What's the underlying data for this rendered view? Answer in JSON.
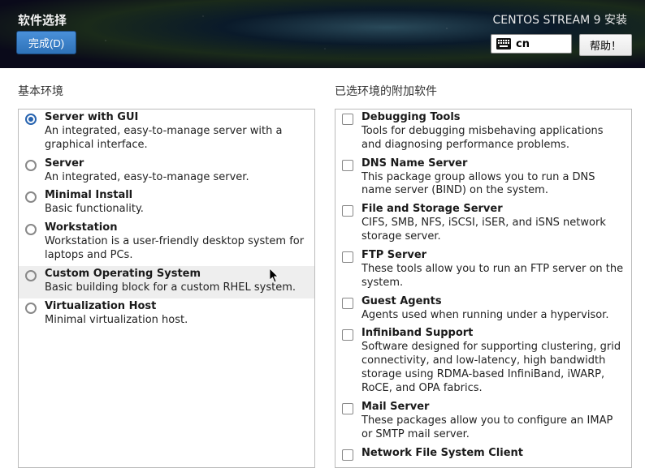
{
  "header": {
    "title": "软件选择",
    "done_label": "完成(D)",
    "installer_title": "CENTOS STREAM 9 安装",
    "lang_code": "cn",
    "help_label": "帮助！"
  },
  "left": {
    "heading": "基本环境",
    "items": [
      {
        "title": "Server with GUI",
        "desc": "An integrated, easy-to-manage server with a graphical interface.",
        "selected": true
      },
      {
        "title": "Server",
        "desc": "An integrated, easy-to-manage server.",
        "selected": false
      },
      {
        "title": "Minimal Install",
        "desc": "Basic functionality.",
        "selected": false
      },
      {
        "title": "Workstation",
        "desc": "Workstation is a user-friendly desktop system for laptops and PCs.",
        "selected": false
      },
      {
        "title": "Custom Operating System",
        "desc": "Basic building block for a custom RHEL system.",
        "selected": false,
        "hovered": true
      },
      {
        "title": "Virtualization Host",
        "desc": "Minimal virtualization host.",
        "selected": false
      }
    ]
  },
  "right": {
    "heading": "已选环境的附加软件",
    "items": [
      {
        "title": "Debugging Tools",
        "desc": "Tools for debugging misbehaving applications and diagnosing performance problems."
      },
      {
        "title": "DNS Name Server",
        "desc": "This package group allows you to run a DNS name server (BIND) on the system."
      },
      {
        "title": "File and Storage Server",
        "desc": "CIFS, SMB, NFS, iSCSI, iSER, and iSNS network storage server."
      },
      {
        "title": "FTP Server",
        "desc": "These tools allow you to run an FTP server on the system."
      },
      {
        "title": "Guest Agents",
        "desc": "Agents used when running under a hypervisor."
      },
      {
        "title": "Infiniband Support",
        "desc": "Software designed for supporting clustering, grid connectivity, and low-latency, high bandwidth storage using RDMA-based InfiniBand, iWARP, RoCE, and OPA fabrics."
      },
      {
        "title": "Mail Server",
        "desc": "These packages allow you to configure an IMAP or SMTP mail server."
      },
      {
        "title": "Network File System Client",
        "desc": ""
      }
    ]
  }
}
